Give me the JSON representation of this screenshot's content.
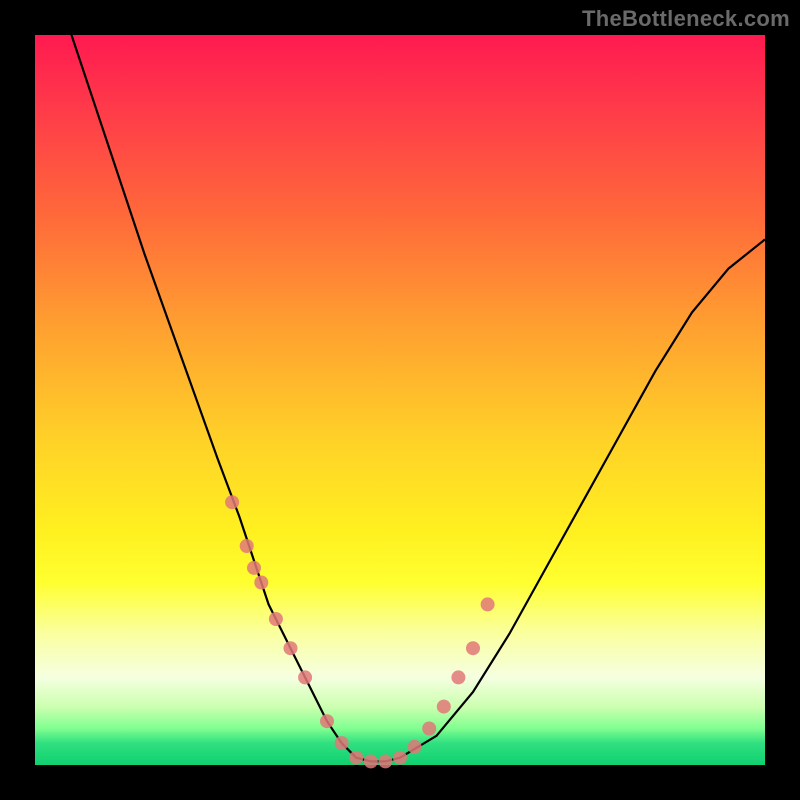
{
  "watermark": "TheBottleneck.com",
  "chart_data": {
    "type": "line",
    "title": "",
    "xlabel": "",
    "ylabel": "",
    "xlim": [
      0,
      100
    ],
    "ylim": [
      0,
      100
    ],
    "series": [
      {
        "name": "bottleneck-curve",
        "x": [
          5,
          10,
          15,
          20,
          25,
          28,
          30,
          32,
          35,
          38,
          40,
          42,
          44,
          46,
          48,
          50,
          55,
          60,
          65,
          70,
          75,
          80,
          85,
          90,
          95,
          100
        ],
        "values": [
          100,
          85,
          70,
          56,
          42,
          34,
          28,
          22,
          16,
          10,
          6,
          3,
          1,
          0.5,
          0.5,
          1,
          4,
          10,
          18,
          27,
          36,
          45,
          54,
          62,
          68,
          72
        ]
      }
    ],
    "markers": {
      "name": "highlight-dots",
      "x": [
        27,
        29,
        30,
        31,
        33,
        35,
        37,
        40,
        42,
        44,
        46,
        48,
        50,
        52,
        54,
        56,
        58,
        60,
        62
      ],
      "values": [
        36,
        30,
        27,
        25,
        20,
        16,
        12,
        6,
        3,
        1,
        0.5,
        0.5,
        1,
        2.5,
        5,
        8,
        12,
        16,
        22
      ]
    }
  }
}
